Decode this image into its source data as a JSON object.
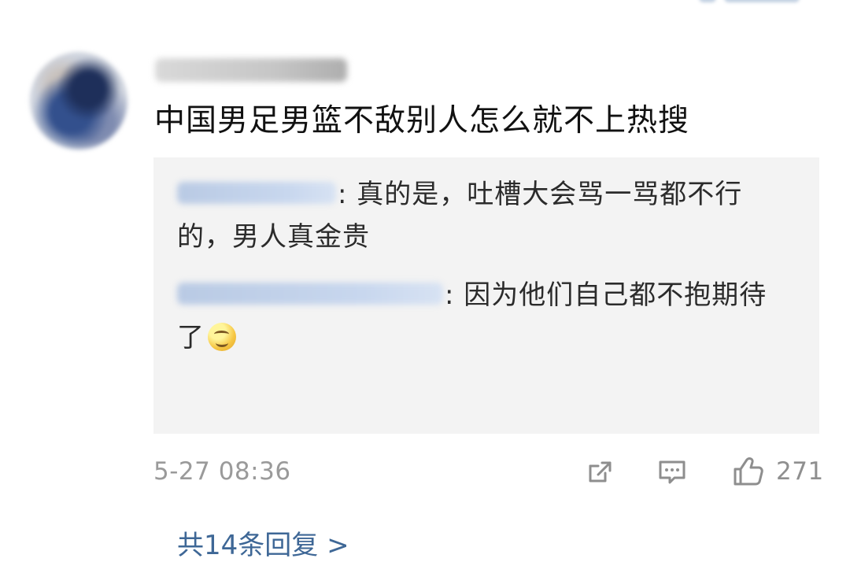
{
  "comment": {
    "text": "中国男足男篮不敌别人怎么就不上热搜"
  },
  "replies": [
    {
      "text": ": 真的是，吐槽大会骂一骂都不行的，男人真金贵"
    },
    {
      "text": ": 因为他们自己都不抱期待了"
    }
  ],
  "more_replies": {
    "label": "共14条回复 >"
  },
  "footer": {
    "timestamp": "5-27 08:36",
    "like_count": "271"
  },
  "icons": {
    "share": "share-icon",
    "comment": "comment-icon",
    "like": "like-icon",
    "emoji": "smile-emoji-icon"
  }
}
